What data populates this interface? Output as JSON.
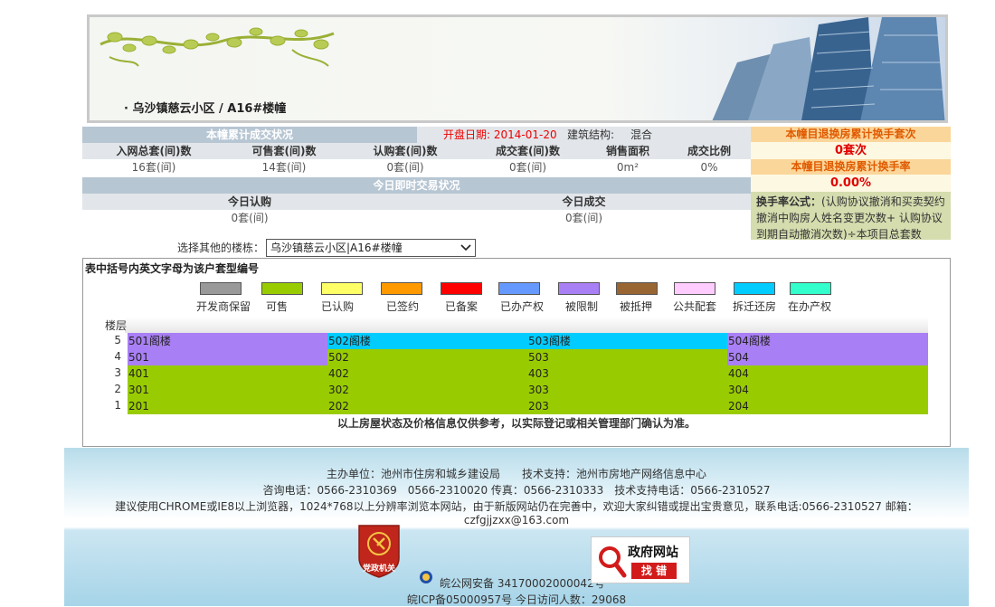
{
  "banner": {
    "title": "· 乌沙镇慈云小区 / A16#楼幢"
  },
  "summary": {
    "bar_title": "本幢累计成交状况",
    "open_date_label": "开盘日期: 2014-01-20",
    "structure_label": "建筑结构:",
    "structure_value": "混合",
    "headers": [
      "入网总套(间)数",
      "可售套(间)数",
      "认购套(间)数",
      "成交套(间)数",
      "销售面积",
      "成交比例"
    ],
    "values": [
      "16套(间)",
      "14套(间)",
      "0套(间)",
      "0套(间)",
      "0m²",
      "0%"
    ]
  },
  "today": {
    "bar_title": "今日即时交易状况",
    "headers": [
      "今日认购",
      "今日成交"
    ],
    "values": [
      "0套(间)",
      "0套(间)"
    ]
  },
  "right_panel": {
    "swap_count_title": "本幢目退换房累计换手套次",
    "swap_count_value": "0套次",
    "swap_rate_title": "本幢目退换房累计换手率",
    "swap_rate_value": "0.00%",
    "formula_label": "换手率公式：",
    "formula_text": "(认购协议撤消和买卖契约撤消中购房人姓名变更次数+ 认购协议到期自动撤消次数)÷本项目总套数"
  },
  "building_select": {
    "label": "选择其他的楼栋：",
    "value": "乌沙镇慈云小区|A16#楼幢"
  },
  "grid": {
    "title": "表中括号内英文字母为该户套型编号",
    "legend": [
      {
        "label": "开发商保留",
        "color": "#999999"
      },
      {
        "label": "可售",
        "color": "#99cc00"
      },
      {
        "label": "已认购",
        "color": "#ffff66"
      },
      {
        "label": "已签约",
        "color": "#ff9900"
      },
      {
        "label": "已备案",
        "color": "#ff0000"
      },
      {
        "label": "已办产权",
        "color": "#6699ff"
      },
      {
        "label": "被限制",
        "color": "#a97ff5"
      },
      {
        "label": "被抵押",
        "color": "#996633"
      },
      {
        "label": "公共配套",
        "color": "#ffccff"
      },
      {
        "label": "拆迁还房",
        "color": "#00ccff"
      },
      {
        "label": "在办产权",
        "color": "#33ffcc"
      }
    ],
    "floor_header": "楼层",
    "floors": [
      {
        "floor": "5",
        "units": [
          {
            "n": "501阁楼",
            "c": "#a97ff5"
          },
          {
            "n": "502阁楼",
            "c": "#00ccff"
          },
          {
            "n": "503阁楼",
            "c": "#00ccff"
          },
          {
            "n": "504阁楼",
            "c": "#a97ff5"
          }
        ]
      },
      {
        "floor": "4",
        "units": [
          {
            "n": "501",
            "c": "#a97ff5"
          },
          {
            "n": "502",
            "c": "#99cc00"
          },
          {
            "n": "503",
            "c": "#99cc00"
          },
          {
            "n": "504",
            "c": "#a97ff5"
          }
        ]
      },
      {
        "floor": "3",
        "units": [
          {
            "n": "401",
            "c": "#99cc00"
          },
          {
            "n": "402",
            "c": "#99cc00"
          },
          {
            "n": "403",
            "c": "#99cc00"
          },
          {
            "n": "404",
            "c": "#99cc00"
          }
        ]
      },
      {
        "floor": "2",
        "units": [
          {
            "n": "301",
            "c": "#99cc00"
          },
          {
            "n": "302",
            "c": "#99cc00"
          },
          {
            "n": "303",
            "c": "#99cc00"
          },
          {
            "n": "304",
            "c": "#99cc00"
          }
        ]
      },
      {
        "floor": "1",
        "units": [
          {
            "n": "201",
            "c": "#99cc00"
          },
          {
            "n": "202",
            "c": "#99cc00"
          },
          {
            "n": "203",
            "c": "#99cc00"
          },
          {
            "n": "204",
            "c": "#99cc00"
          }
        ]
      }
    ],
    "note": "以上房屋状态及价格信息仅供参考，以实际登记或相关管理部门确认为准。"
  },
  "footer": {
    "line1": "主办单位：池州市住房和城乡建设局　　技术支持：池州市房地产网络信息中心",
    "line2": "咨询电话：0566-2310369　0566-2310020 传真：0566-2310333　技术支持电话：0566-2310527",
    "line3": "建议使用CHROME或IE8以上浏览器，1024*768以上分辨率浏览本网站，由于新版网站仍在完善中，欢迎大家纠错或提出宝贵意见，联系电话:0566-2310527 邮箱：czfgjjzxx@163.com",
    "police_record": "皖公网安备 34170002000042号",
    "icp_visits": "皖ICP备05000957号 今日访问人数：29068",
    "party_badge": "党政机关",
    "gov_error_title": "政府网站",
    "gov_error_sub": "找 错"
  }
}
